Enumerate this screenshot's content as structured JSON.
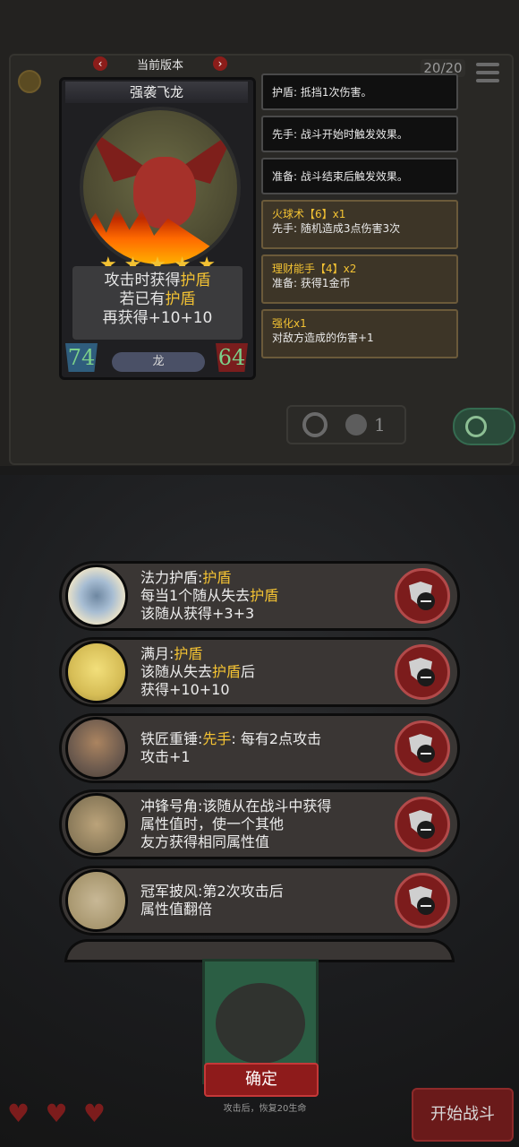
{
  "version_selector": {
    "label": "当前版本",
    "prev_icon": "chevron-left-icon",
    "next_icon": "chevron-right-icon"
  },
  "card": {
    "name": "强袭飞龙",
    "stars": 5,
    "description_line1_prefix": "攻击时获得",
    "description_line1_highlight": "护盾",
    "description_line2_prefix": "若已有",
    "description_line2_highlight": "护盾",
    "description_line3": "再获得+10+10",
    "attack": "74",
    "health": "64",
    "tribe": "龙"
  },
  "keywords": [
    {
      "type": "basic",
      "text": "护盾: 抵挡1次伤害。"
    },
    {
      "type": "basic",
      "text": "先手: 战斗开始时触发效果。"
    },
    {
      "type": "basic",
      "text": "准备: 战斗结束后触发效果。"
    },
    {
      "type": "enh",
      "title": "火球术【6】x1",
      "desc": "先手: 随机造成3点伤害3次"
    },
    {
      "type": "enh",
      "title": "理财能手【4】x2",
      "desc": "准备: 获得1金币"
    },
    {
      "type": "enh",
      "title": "强化x1",
      "desc": "对敌方造成的伤害+1"
    }
  ],
  "top_counter": "20/20",
  "shop_counter": "1",
  "effects": [
    {
      "icon": "blue",
      "line1_prefix": "法力护盾:",
      "line1_highlight": "护盾",
      "line2_prefix": "每当1个随从失去",
      "line2_highlight": "护盾",
      "line3": "该随从获得+3+3"
    },
    {
      "icon": "moon",
      "line1_prefix": "满月:",
      "line1_highlight": "护盾",
      "line2_prefix": "该随从失去",
      "line2_highlight": "护盾",
      "line2_suffix": "后",
      "line3": "获得+10+10"
    },
    {
      "icon": "hammer",
      "line1_prefix": "铁匠重锤:",
      "line1_highlight": "先手",
      "line1_suffix": ": 每有2点攻击",
      "line2": "攻击+1"
    },
    {
      "icon": "horn",
      "line1": "冲锋号角:该随从在战斗中获得",
      "line2": "属性值时，使一个其他",
      "line3": "友方获得相同属性值"
    },
    {
      "icon": "cape",
      "line1": "冠军披风:第2次攻击后",
      "line2": "属性值翻倍"
    }
  ],
  "confirm_label": "确定",
  "hint_text": "攻击后，恢复20生命",
  "start_battle_label": "开始战斗"
}
